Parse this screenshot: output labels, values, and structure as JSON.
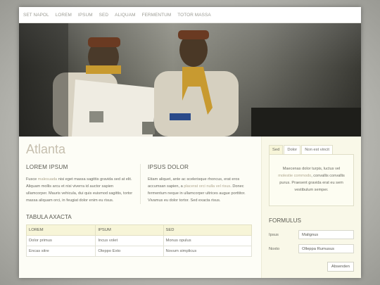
{
  "nav": {
    "items": [
      "SET NAPOL",
      "LOREM",
      "IPSUM",
      "SED",
      "ALIQUAM",
      "FERMENTUM",
      "TOTOR MASSA"
    ]
  },
  "site_title": "Atlanta",
  "col1": {
    "heading": "LOREM IPSUM",
    "text_a": "Fusce ",
    "link": "malesuada",
    "text_b": " nisi eget massa sagittis gravida sed at elit. Aliquam mollis arcu et nisi viverra id auctor sapien ullamcorper. Mauris vehicula, dui quis euismod sagittis, tortor massa aliquam orci, in feugiat dolor enim eu risus."
  },
  "col2": {
    "heading": "IPSUS DOLOR",
    "text_a": "Etiam aliquet, ante ac scelerisque rhoncus, erat eros accumsan sapien, a ",
    "link": "placerat orci nulla vel risus",
    "text_b": ". Donec fermentum neque in ullamcorper ultrices augue porttitor. Vivamus eu dolor tortor. Sed exacta risus."
  },
  "table": {
    "title": "TABULA AXACTA",
    "headers": [
      "LOREM",
      "IPSUM",
      "SED"
    ],
    "rows": [
      [
        "Dolor primus",
        "Incus volet",
        "Monus opulus"
      ],
      [
        "Encas sitre",
        "Oleppo Exto",
        "Novum simplicus"
      ]
    ]
  },
  "side": {
    "tabs": [
      "Sed",
      "Dolor",
      "Non est vincit"
    ],
    "panel_a": "Maecenas dolor turpis, luctus vel ",
    "panel_link": "molestie commodo",
    "panel_b": ", convallis convallis purus. Praesent gravida erat eu sem vestibulum semper.",
    "form_title": "FORMULUS",
    "fields": [
      {
        "label": "Ipsus",
        "value": "Malignus"
      },
      {
        "label": "Noxto",
        "value": "Olleppa Rumusus"
      }
    ],
    "submit": "Absenden"
  },
  "colors": {
    "accent": "#c6bfae",
    "sidebar_bg": "#f9f8e8",
    "link": "#b0a890"
  }
}
